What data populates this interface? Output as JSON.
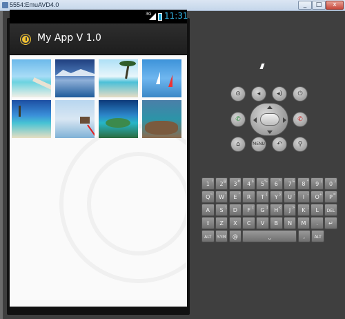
{
  "window": {
    "title": "5554:EmuAVD4.0",
    "buttons": {
      "minimize": "_",
      "maximize": "□",
      "close": "x"
    }
  },
  "status_bar": {
    "network_type": "3G",
    "time": "11:31",
    "icons": [
      "signal-icon",
      "battery-icon"
    ]
  },
  "action_bar": {
    "title": "My App V 1.0",
    "logo_icon": "clock-icon"
  },
  "gallery": {
    "thumbnails": [
      {
        "name": "beach-pier"
      },
      {
        "name": "lake-mountains"
      },
      {
        "name": "tropical-beach-palm"
      },
      {
        "name": "sailboats"
      },
      {
        "name": "island-shore"
      },
      {
        "name": "beach-hut"
      },
      {
        "name": "aerial-island"
      },
      {
        "name": "rocky-coast"
      }
    ],
    "columns": 4
  },
  "controls": {
    "row1": [
      "camera-icon",
      "volume-down-icon",
      "volume-up-icon",
      "power-icon"
    ],
    "call_icon": "call-icon",
    "end_call_icon": "end-call-icon",
    "row3": [
      {
        "icon": "home-icon",
        "label": ""
      },
      {
        "icon": "menu-icon",
        "label": "MENU"
      },
      {
        "icon": "back-icon",
        "label": ""
      },
      {
        "icon": "search-icon",
        "label": ""
      }
    ]
  },
  "keyboard": {
    "row1": [
      {
        "k": "1",
        "s": "!"
      },
      {
        "k": "2",
        "s": "@"
      },
      {
        "k": "3",
        "s": "#"
      },
      {
        "k": "4",
        "s": "$"
      },
      {
        "k": "5",
        "s": "%"
      },
      {
        "k": "6",
        "s": "^"
      },
      {
        "k": "7",
        "s": "&"
      },
      {
        "k": "8",
        "s": "*"
      },
      {
        "k": "9",
        "s": "("
      },
      {
        "k": "0",
        "s": ")"
      }
    ],
    "row2": [
      {
        "k": "Q",
        "s": "~"
      },
      {
        "k": "W",
        "s": "\""
      },
      {
        "k": "E",
        "s": "\""
      },
      {
        "k": "R",
        "s": ""
      },
      {
        "k": "T",
        "s": "{"
      },
      {
        "k": "Y",
        "s": "}"
      },
      {
        "k": "U",
        "s": "-"
      },
      {
        "k": "I",
        "s": "-"
      },
      {
        "k": "O",
        "s": "+"
      },
      {
        "k": "P",
        "s": "="
      }
    ],
    "row3": [
      {
        "k": "A",
        "s": ""
      },
      {
        "k": "S",
        "s": "\\"
      },
      {
        "k": "D",
        "s": ""
      },
      {
        "k": "F",
        "s": "["
      },
      {
        "k": "G",
        "s": "]"
      },
      {
        "k": "H",
        "s": "<"
      },
      {
        "k": "J",
        "s": ">"
      },
      {
        "k": "K",
        "s": ";"
      },
      {
        "k": "L",
        "s": ":"
      },
      {
        "k": "DEL",
        "s": ""
      }
    ],
    "row4": [
      {
        "k": "⇧",
        "s": ""
      },
      {
        "k": "Z",
        "s": ""
      },
      {
        "k": "X",
        "s": ""
      },
      {
        "k": "C",
        "s": ""
      },
      {
        "k": "V",
        "s": ""
      },
      {
        "k": "B",
        "s": ""
      },
      {
        "k": "N",
        "s": ""
      },
      {
        "k": "M",
        "s": ""
      },
      {
        "k": ".",
        "s": ""
      },
      {
        "k": "↵",
        "s": ""
      }
    ],
    "row5": [
      {
        "k": "ALT",
        "s": ""
      },
      {
        "k": "SYM",
        "s": ""
      },
      {
        "k": "@",
        "s": ""
      },
      {
        "k": "⎵",
        "s": ""
      },
      {
        "k": ",",
        "s": ""
      },
      {
        "k": "ALT",
        "s": ""
      }
    ]
  },
  "colors": {
    "emulator_bg": "#3f3f3f",
    "status_time": "#33b5e5",
    "logo": "#f1c232",
    "annotation_arrow": "#e31b1b"
  }
}
